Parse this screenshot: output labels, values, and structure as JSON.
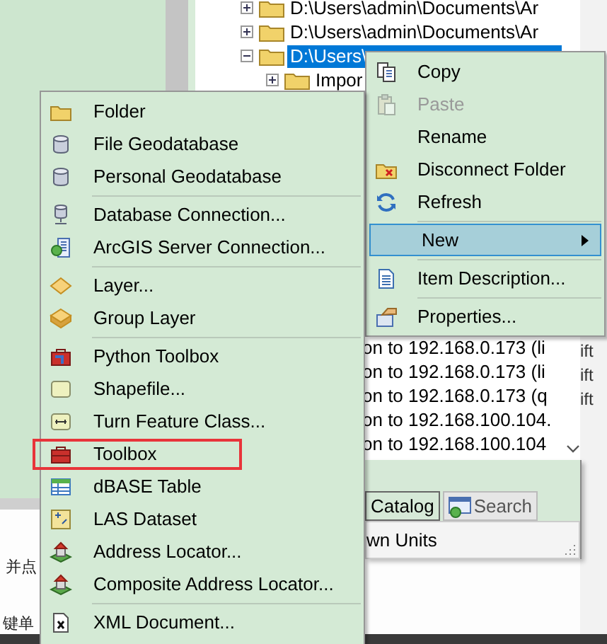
{
  "page_texts": [
    "并点",
    "键单"
  ],
  "tree": {
    "items": [
      {
        "label": "D:\\Users\\admin\\Documents\\Ar",
        "expanded": false,
        "selected": false
      },
      {
        "label": "D:\\Users\\admin\\Documents\\Ar",
        "expanded": false,
        "selected": false
      },
      {
        "label": "D:\\Users\\",
        "expanded": true,
        "selected": true,
        "children": [
          {
            "label": "Impor",
            "expanded": false,
            "selected": false
          }
        ]
      }
    ]
  },
  "connections": [
    "on to 192.168.0.173 (li",
    "on to 192.168.0.173 (li",
    "on to 192.168.0.173 (q",
    "on to 192.168.100.104.",
    "on to 192.168.100.104"
  ],
  "side_texts": [
    "ift",
    "ift",
    "ift"
  ],
  "tabs": [
    {
      "label": "Catalog",
      "selected": true
    },
    {
      "label": "Search",
      "selected": false
    }
  ],
  "units_field": "wn Units",
  "context_menu": {
    "items": [
      {
        "kind": "item",
        "label": "Copy",
        "disabled": false,
        "selected": false
      },
      {
        "kind": "item",
        "label": "Paste",
        "disabled": true,
        "selected": false
      },
      {
        "kind": "item",
        "label": "Rename",
        "disabled": false,
        "selected": false
      },
      {
        "kind": "item",
        "label": "Disconnect Folder",
        "disabled": false,
        "selected": false
      },
      {
        "kind": "item",
        "label": "Refresh",
        "disabled": false,
        "selected": false
      },
      {
        "kind": "separator"
      },
      {
        "kind": "submenu",
        "label": "New",
        "disabled": false,
        "selected": true
      },
      {
        "kind": "separator"
      },
      {
        "kind": "item",
        "label": "Item Description...",
        "disabled": false,
        "selected": false
      },
      {
        "kind": "separator"
      },
      {
        "kind": "item",
        "label": "Properties...",
        "disabled": false,
        "selected": false
      }
    ]
  },
  "new_submenu": {
    "items": [
      {
        "kind": "item",
        "label": "Folder",
        "outlined": false
      },
      {
        "kind": "item",
        "label": "File Geodatabase",
        "outlined": false
      },
      {
        "kind": "item",
        "label": "Personal Geodatabase",
        "outlined": false
      },
      {
        "kind": "separator"
      },
      {
        "kind": "item",
        "label": "Database Connection...",
        "outlined": false
      },
      {
        "kind": "item",
        "label": "ArcGIS Server Connection...",
        "outlined": false
      },
      {
        "kind": "separator"
      },
      {
        "kind": "item",
        "label": "Layer...",
        "outlined": false
      },
      {
        "kind": "item",
        "label": "Group Layer",
        "outlined": false
      },
      {
        "kind": "separator"
      },
      {
        "kind": "item",
        "label": "Python Toolbox",
        "outlined": false
      },
      {
        "kind": "item",
        "label": "Shapefile...",
        "outlined": false
      },
      {
        "kind": "item",
        "label": "Turn Feature Class...",
        "outlined": false
      },
      {
        "kind": "item",
        "label": "Toolbox",
        "outlined": true
      },
      {
        "kind": "item",
        "label": "dBASE Table",
        "outlined": false
      },
      {
        "kind": "item",
        "label": "LAS Dataset",
        "outlined": false
      },
      {
        "kind": "item",
        "label": "Address Locator...",
        "outlined": false
      },
      {
        "kind": "item",
        "label": "Composite Address Locator...",
        "outlined": false
      },
      {
        "kind": "separator"
      },
      {
        "kind": "item",
        "label": "XML Document...",
        "outlined": false
      }
    ]
  }
}
